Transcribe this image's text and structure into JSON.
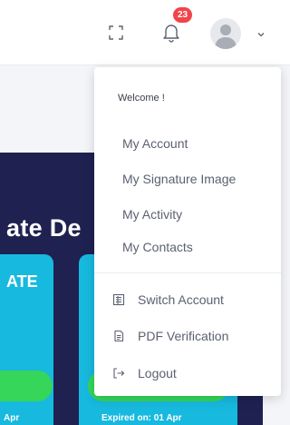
{
  "header": {
    "notification_count": "23",
    "icons": {
      "fullscreen": "fullscreen-icon",
      "notifications": "bell-icon",
      "avatar": "user-avatar",
      "dropdown": "chevron-down-icon"
    }
  },
  "banner": {
    "title": "ate De",
    "cards": [
      {
        "title": "ATE",
        "expiry": "Apr"
      },
      {
        "title": "",
        "expiry": "Expired on: 01 Apr"
      }
    ]
  },
  "user_menu": {
    "welcome": "Welcome !",
    "items": [
      {
        "label": "My Account"
      },
      {
        "label": "My Signature Image"
      },
      {
        "label": "My Activity"
      },
      {
        "label": "My Contacts"
      }
    ],
    "actions": [
      {
        "label": "Switch Account",
        "icon": "switch-account-icon"
      },
      {
        "label": "PDF Verification",
        "icon": "document-icon"
      },
      {
        "label": "Logout",
        "icon": "logout-icon"
      }
    ]
  },
  "colors": {
    "banner": "#1f2151",
    "card": "#17b9df",
    "button": "#35d65a",
    "badge": "#f1444a"
  }
}
